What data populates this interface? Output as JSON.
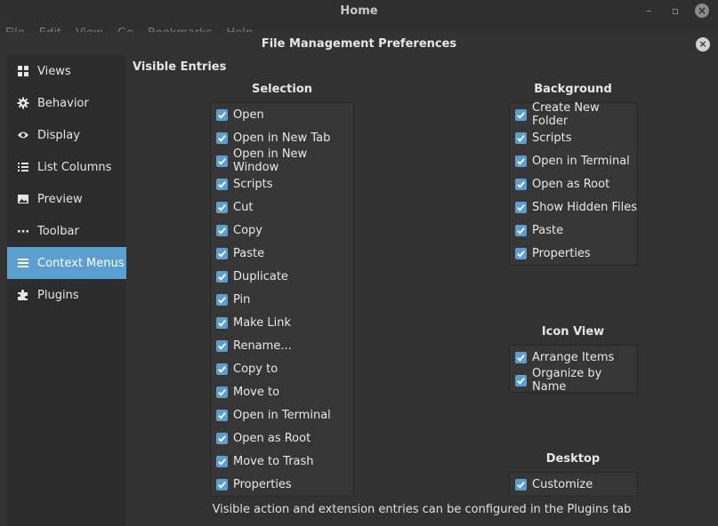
{
  "background_window": {
    "title": "Home",
    "menu": [
      "File",
      "Edit",
      "View",
      "Go",
      "Bookmarks",
      "Help"
    ]
  },
  "dialog": {
    "title": "File Management Preferences"
  },
  "sidebar": {
    "items": [
      {
        "label": "Views",
        "icon": "grid-icon"
      },
      {
        "label": "Behavior",
        "icon": "gear-icon"
      },
      {
        "label": "Display",
        "icon": "eye-icon"
      },
      {
        "label": "List Columns",
        "icon": "list-icon"
      },
      {
        "label": "Preview",
        "icon": "image-icon"
      },
      {
        "label": "Toolbar",
        "icon": "dots-icon"
      },
      {
        "label": "Context Menus",
        "icon": "menu-icon",
        "active": true
      },
      {
        "label": "Plugins",
        "icon": "puzzle-icon"
      }
    ]
  },
  "main": {
    "section_title": "Visible Entries",
    "selection": {
      "heading": "Selection",
      "items": [
        "Open",
        "Open in New Tab",
        "Open in New Window",
        "Scripts",
        "Cut",
        "Copy",
        "Paste",
        "Duplicate",
        "Pin",
        "Make Link",
        "Rename...",
        "Copy to",
        "Move to",
        "Open in Terminal",
        "Open as Root",
        "Move to Trash",
        "Properties"
      ]
    },
    "background": {
      "heading": "Background",
      "items": [
        "Create New Folder",
        "Scripts",
        "Open in Terminal",
        "Open as Root",
        "Show Hidden Files",
        "Paste",
        "Properties"
      ]
    },
    "icon_view": {
      "heading": "Icon View",
      "items": [
        "Arrange Items",
        "Organize by Name"
      ]
    },
    "desktop": {
      "heading": "Desktop",
      "items": [
        "Customize"
      ]
    },
    "footer": "Visible action and extension entries can be configured in the Plugins tab"
  },
  "colors": {
    "accent": "#5a9fcf",
    "dialog_bg": "#323232",
    "sidebar_bg": "#2c2c2c"
  }
}
